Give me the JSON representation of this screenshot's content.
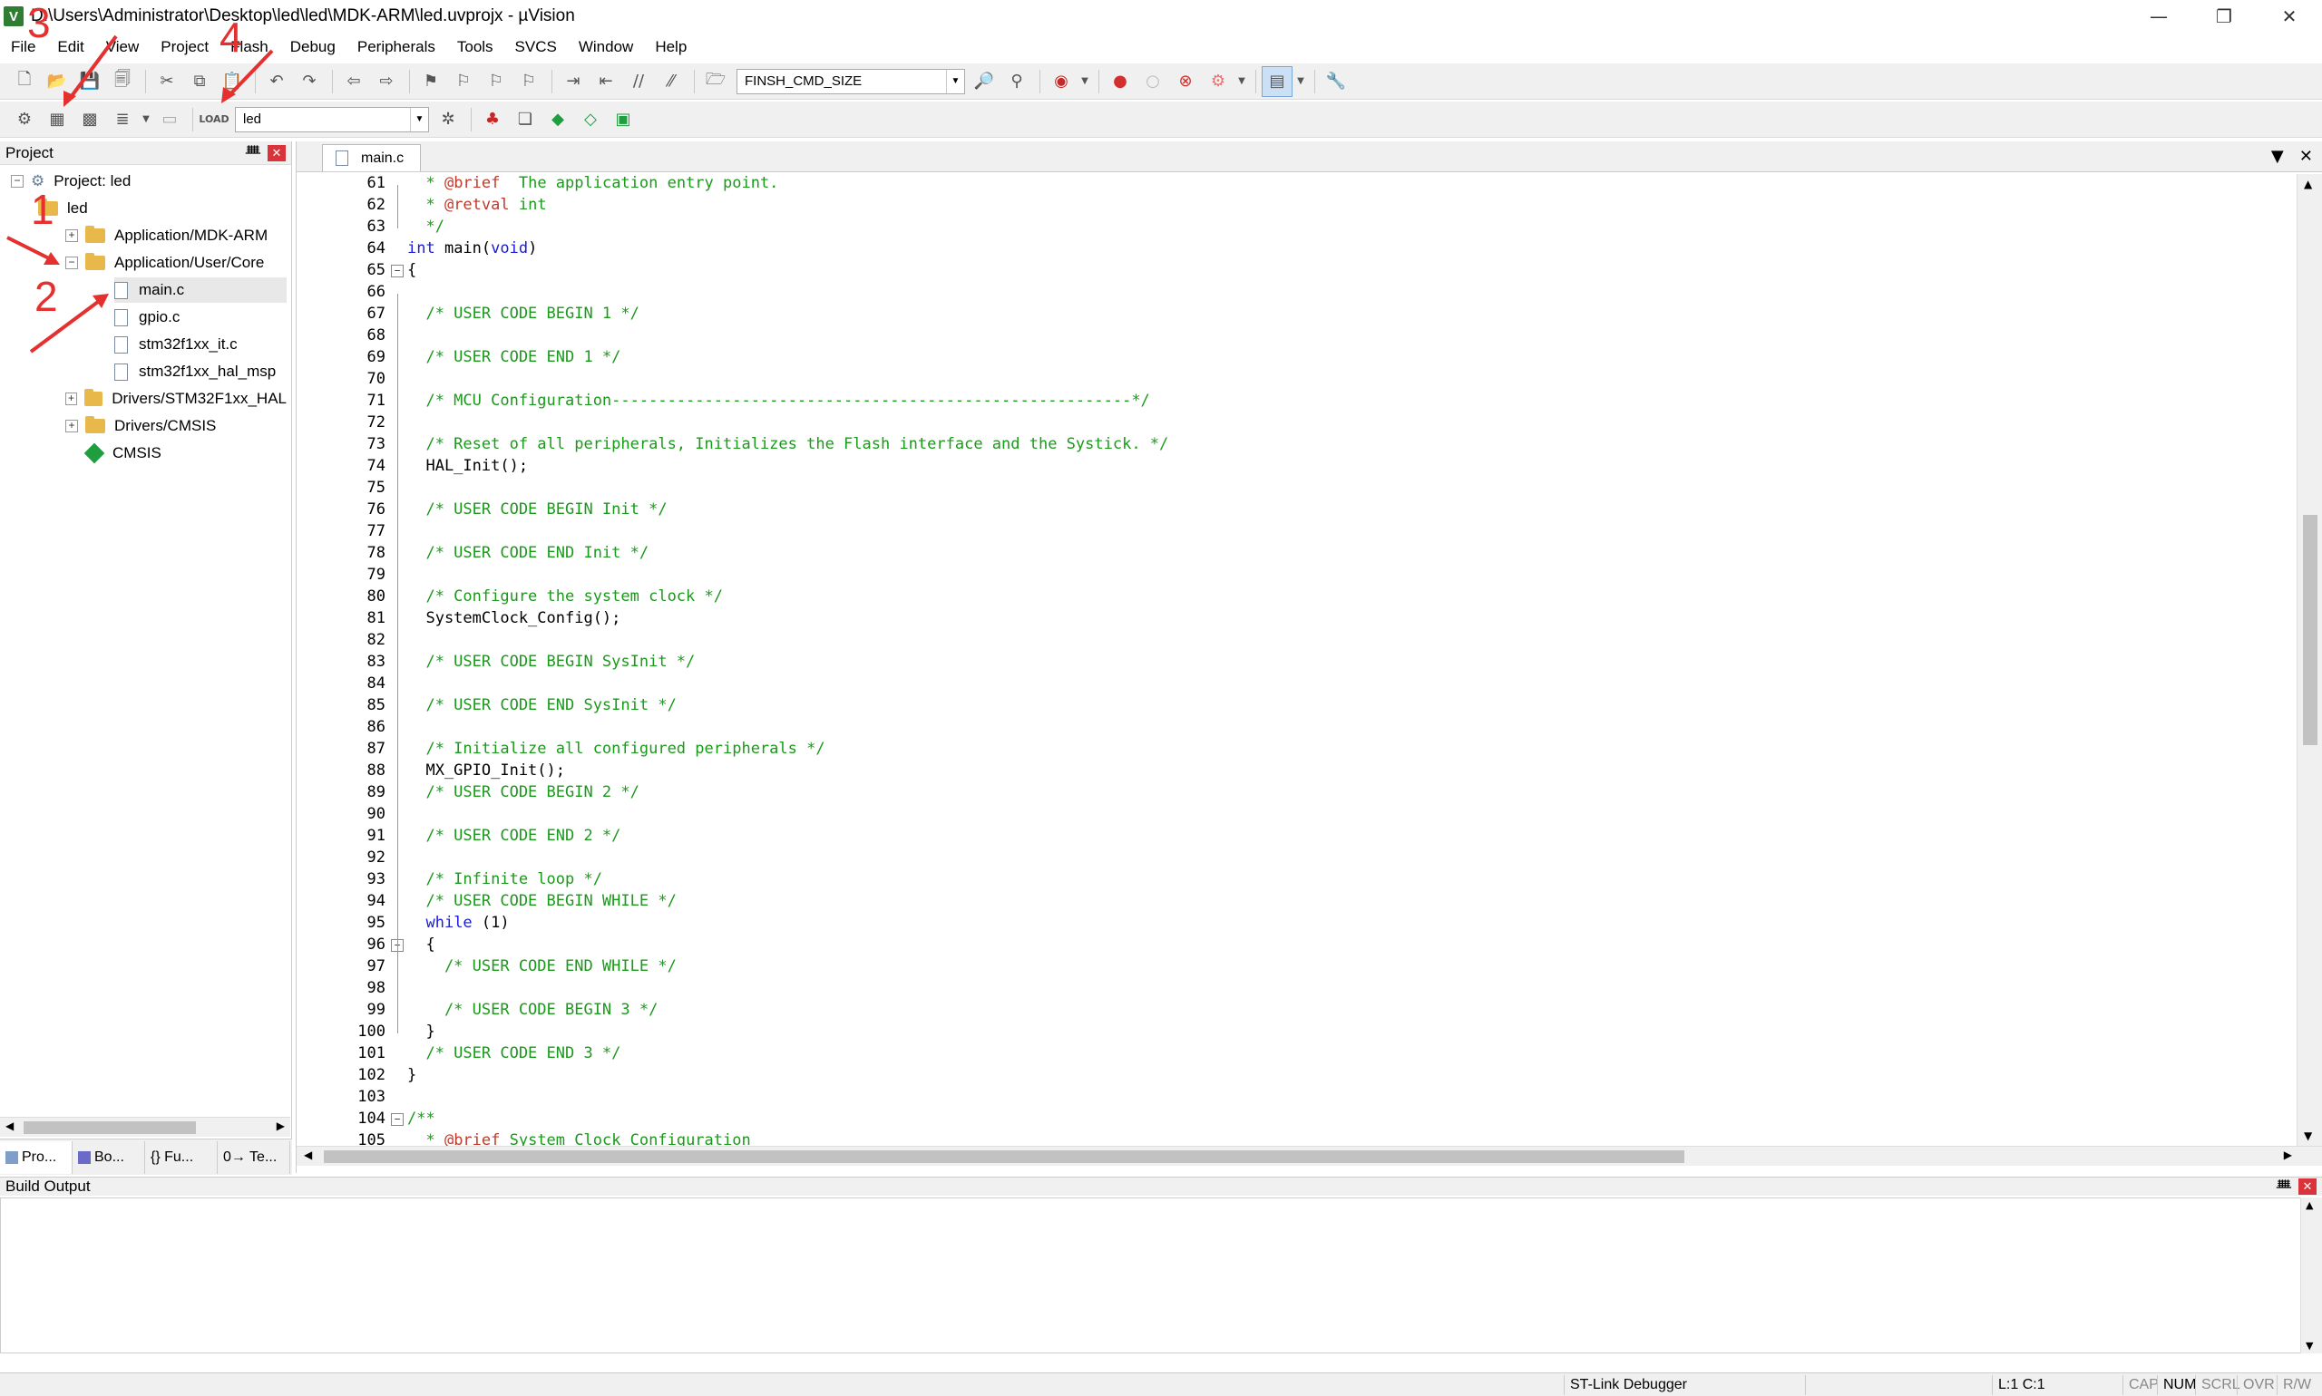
{
  "window": {
    "title": "D:\\Users\\Administrator\\Desktop\\led\\led\\MDK-ARM\\led.uvprojx - µVision",
    "icon_letter": "V",
    "controls": [
      "—",
      "❐",
      "✕"
    ]
  },
  "menu": [
    "File",
    "Edit",
    "View",
    "Project",
    "Flash",
    "Debug",
    "Peripherals",
    "Tools",
    "SVCS",
    "Window",
    "Help"
  ],
  "toolbar1": {
    "find_combo": "FINSH_CMD_SIZE"
  },
  "toolbar2": {
    "target_combo": "led"
  },
  "project_panel": {
    "title": "Project",
    "pin": "ᚙ",
    "close": "✕",
    "tree": {
      "root": "Project: led",
      "target": "led",
      "groups": [
        {
          "label": "Application/MDK-ARM",
          "expander": "+"
        },
        {
          "label": "Application/User/Core",
          "expander": "−"
        },
        {
          "label": "Drivers/STM32F1xx_HAL",
          "expander": "+"
        },
        {
          "label": "Drivers/CMSIS",
          "expander": "+"
        }
      ],
      "files": [
        "main.c",
        "gpio.c",
        "stm32f1xx_it.c",
        "stm32f1xx_hal_msp"
      ],
      "component": "CMSIS"
    },
    "tabs": [
      "Pro...",
      "Bo...",
      "{} Fu...",
      "0→ Te..."
    ]
  },
  "editor": {
    "tab": "main.c",
    "lines": [
      {
        "n": "61",
        "parts": [
          {
            "t": "  * ",
            "c": "cm"
          },
          {
            "t": "@brief",
            "c": "tag"
          },
          {
            "t": "  The application entry point.",
            "c": "cm"
          }
        ]
      },
      {
        "n": "62",
        "parts": [
          {
            "t": "  * ",
            "c": "cm"
          },
          {
            "t": "@retval",
            "c": "tag"
          },
          {
            "t": " int",
            "c": "cm"
          }
        ]
      },
      {
        "n": "63",
        "parts": [
          {
            "t": "  */",
            "c": "cm"
          }
        ]
      },
      {
        "n": "64",
        "parts": [
          {
            "t": "int",
            "c": "kw"
          },
          {
            "t": " main(",
            "c": ""
          },
          {
            "t": "void",
            "c": "kw"
          },
          {
            "t": ")",
            "c": ""
          }
        ]
      },
      {
        "n": "65",
        "parts": [
          {
            "t": "{",
            "c": ""
          }
        ]
      },
      {
        "n": "66",
        "parts": []
      },
      {
        "n": "67",
        "parts": [
          {
            "t": "  /* USER CODE BEGIN 1 */",
            "c": "cm"
          }
        ]
      },
      {
        "n": "68",
        "parts": []
      },
      {
        "n": "69",
        "parts": [
          {
            "t": "  /* USER CODE END 1 */",
            "c": "cm"
          }
        ]
      },
      {
        "n": "70",
        "parts": []
      },
      {
        "n": "71",
        "parts": [
          {
            "t": "  /* MCU Configuration--------------------------------------------------------*/",
            "c": "cm"
          }
        ]
      },
      {
        "n": "72",
        "parts": []
      },
      {
        "n": "73",
        "parts": [
          {
            "t": "  /* Reset of all peripherals, Initializes the Flash interface and the Systick. */",
            "c": "cm"
          }
        ]
      },
      {
        "n": "74",
        "parts": [
          {
            "t": "  HAL_Init();",
            "c": ""
          }
        ]
      },
      {
        "n": "75",
        "parts": []
      },
      {
        "n": "76",
        "parts": [
          {
            "t": "  /* USER CODE BEGIN Init */",
            "c": "cm"
          }
        ]
      },
      {
        "n": "77",
        "parts": []
      },
      {
        "n": "78",
        "parts": [
          {
            "t": "  /* USER CODE END Init */",
            "c": "cm"
          }
        ]
      },
      {
        "n": "79",
        "parts": []
      },
      {
        "n": "80",
        "parts": [
          {
            "t": "  /* Configure the system clock */",
            "c": "cm"
          }
        ]
      },
      {
        "n": "81",
        "parts": [
          {
            "t": "  SystemClock_Config();",
            "c": ""
          }
        ]
      },
      {
        "n": "82",
        "parts": []
      },
      {
        "n": "83",
        "parts": [
          {
            "t": "  /* USER CODE BEGIN SysInit */",
            "c": "cm"
          }
        ]
      },
      {
        "n": "84",
        "parts": []
      },
      {
        "n": "85",
        "parts": [
          {
            "t": "  /* USER CODE END SysInit */",
            "c": "cm"
          }
        ]
      },
      {
        "n": "86",
        "parts": []
      },
      {
        "n": "87",
        "parts": [
          {
            "t": "  /* Initialize all configured peripherals */",
            "c": "cm"
          }
        ]
      },
      {
        "n": "88",
        "parts": [
          {
            "t": "  MX_GPIO_Init();",
            "c": ""
          }
        ]
      },
      {
        "n": "89",
        "parts": [
          {
            "t": "  /* USER CODE BEGIN 2 */",
            "c": "cm"
          }
        ]
      },
      {
        "n": "90",
        "parts": []
      },
      {
        "n": "91",
        "parts": [
          {
            "t": "  /* USER CODE END 2 */",
            "c": "cm"
          }
        ]
      },
      {
        "n": "92",
        "parts": []
      },
      {
        "n": "93",
        "parts": [
          {
            "t": "  /* Infinite loop */",
            "c": "cm"
          }
        ]
      },
      {
        "n": "94",
        "parts": [
          {
            "t": "  /* USER CODE BEGIN WHILE */",
            "c": "cm"
          }
        ]
      },
      {
        "n": "95",
        "parts": [
          {
            "t": "  ",
            "c": ""
          },
          {
            "t": "while",
            "c": "kw"
          },
          {
            "t": " (1)",
            "c": ""
          }
        ]
      },
      {
        "n": "96",
        "parts": [
          {
            "t": "  {",
            "c": ""
          }
        ]
      },
      {
        "n": "97",
        "parts": [
          {
            "t": "    /* USER CODE END WHILE */",
            "c": "cm"
          }
        ]
      },
      {
        "n": "98",
        "parts": []
      },
      {
        "n": "99",
        "parts": [
          {
            "t": "    /* USER CODE BEGIN 3 */",
            "c": "cm"
          }
        ]
      },
      {
        "n": "100",
        "parts": [
          {
            "t": "  }",
            "c": ""
          }
        ]
      },
      {
        "n": "101",
        "parts": [
          {
            "t": "  /* USER CODE END 3 */",
            "c": "cm"
          }
        ]
      },
      {
        "n": "102",
        "parts": [
          {
            "t": "}",
            "c": ""
          }
        ]
      },
      {
        "n": "103",
        "parts": []
      },
      {
        "n": "104",
        "parts": [
          {
            "t": "/**",
            "c": "cm"
          }
        ]
      },
      {
        "n": "105",
        "parts": [
          {
            "t": "  * ",
            "c": "cm"
          },
          {
            "t": "@brief",
            "c": "tag"
          },
          {
            "t": " System Clock Configuration",
            "c": "cm"
          }
        ]
      }
    ]
  },
  "build_output": {
    "title": "Build Output"
  },
  "status": {
    "debugger": "ST-Link Debugger",
    "position": "L:1 C:1",
    "indicators": [
      "CAP",
      "NUM",
      "SCRL",
      "OVR",
      "R/W"
    ]
  },
  "annotations": [
    "1",
    "2",
    "3",
    "4"
  ],
  "colors": {
    "comment": "#1a9a1a",
    "keyword": "#1b1bd8",
    "doc_tag": "#c0392b",
    "annotation": "#e53030"
  }
}
